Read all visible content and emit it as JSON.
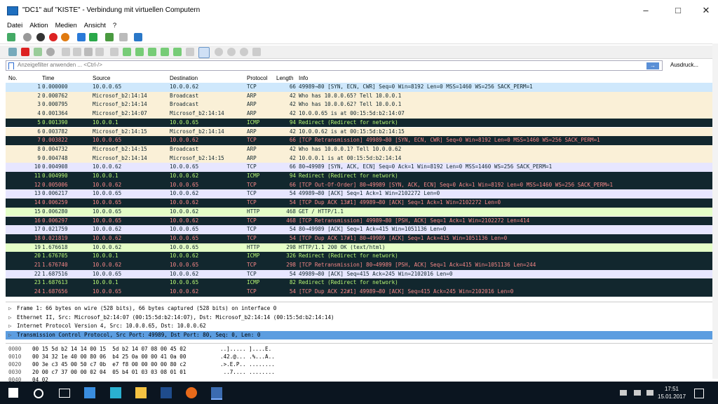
{
  "window": {
    "title": "\"DC1\" auf \"KISTE\" - Verbindung mit virtuellen Computern"
  },
  "menu": [
    "Datei",
    "Aktion",
    "Medien",
    "Ansicht",
    "?"
  ],
  "filter": {
    "placeholder": "Anzeigefilter anwenden ... <Ctrl-/>",
    "expression_label": "Ausdruck..."
  },
  "columns": [
    "No.",
    "Time",
    "Source",
    "Destination",
    "Protocol",
    "Length",
    "Info"
  ],
  "packets": [
    {
      "no": "1",
      "time": "0.000000",
      "src": "10.0.0.65",
      "dst": "10.0.0.62",
      "proto": "TCP",
      "len": "66",
      "info": "49989→80 [SYN, ECN, CWR] Seq=0 Win=8192 Len=0 MSS=1460 WS=256 SACK_PERM=1",
      "style": "sel"
    },
    {
      "no": "2",
      "time": "0.000762",
      "src": "Microsof_b2:14:14",
      "dst": "Broadcast",
      "proto": "ARP",
      "len": "42",
      "info": "Who has 10.0.0.65? Tell 10.0.0.1",
      "style": "arp"
    },
    {
      "no": "3",
      "time": "0.000795",
      "src": "Microsof_b2:14:14",
      "dst": "Broadcast",
      "proto": "ARP",
      "len": "42",
      "info": "Who has 10.0.0.62? Tell 10.0.0.1",
      "style": "arp"
    },
    {
      "no": "4",
      "time": "0.001364",
      "src": "Microsof_b2:14:07",
      "dst": "Microsof_b2:14:14",
      "proto": "ARP",
      "len": "42",
      "info": "10.0.0.65 is at 00:15:5d:b2:14:07",
      "style": "arp"
    },
    {
      "no": "5",
      "time": "0.001390",
      "src": "10.0.0.1",
      "dst": "10.0.0.65",
      "proto": "ICMP",
      "len": "94",
      "info": "Redirect             (Redirect for network)",
      "style": "icmp"
    },
    {
      "no": "6",
      "time": "0.003782",
      "src": "Microsof_b2:14:15",
      "dst": "Microsof_b2:14:14",
      "proto": "ARP",
      "len": "42",
      "info": "10.0.0.62 is at 00:15:5d:b2:14:15",
      "style": "arp"
    },
    {
      "no": "7",
      "time": "0.003822",
      "src": "10.0.0.65",
      "dst": "10.0.0.62",
      "proto": "TCP",
      "len": "66",
      "info": "[TCP Retransmission] 49989→80 [SYN, ECN, CWR] Seq=0 Win=8192 Len=0 MSS=1460 WS=256 SACK_PERM=1",
      "style": "bad"
    },
    {
      "no": "8",
      "time": "0.004732",
      "src": "Microsof_b2:14:15",
      "dst": "Broadcast",
      "proto": "ARP",
      "len": "42",
      "info": "Who has 10.0.0.1? Tell 10.0.0.62",
      "style": "arp"
    },
    {
      "no": "9",
      "time": "0.004748",
      "src": "Microsof_b2:14:14",
      "dst": "Microsof_b2:14:15",
      "proto": "ARP",
      "len": "42",
      "info": "10.0.0.1 is at 00:15:5d:b2:14:14",
      "style": "arp"
    },
    {
      "no": "10",
      "time": "0.004908",
      "src": "10.0.0.62",
      "dst": "10.0.0.65",
      "proto": "TCP",
      "len": "66",
      "info": "80→49989 [SYN, ACK, ECN] Seq=0 Ack=1 Win=8192 Len=0 MSS=1460 WS=256 SACK_PERM=1",
      "style": "tcpok"
    },
    {
      "no": "11",
      "time": "0.004990",
      "src": "10.0.0.1",
      "dst": "10.0.0.62",
      "proto": "ICMP",
      "len": "94",
      "info": "Redirect             (Redirect for network)",
      "style": "icmp"
    },
    {
      "no": "12",
      "time": "0.005006",
      "src": "10.0.0.62",
      "dst": "10.0.0.65",
      "proto": "TCP",
      "len": "66",
      "info": "[TCP Out-Of-Order] 80→49989 [SYN, ACK, ECN] Seq=0 Ack=1 Win=8192 Len=0 MSS=1460 WS=256 SACK_PERM=1",
      "style": "bad"
    },
    {
      "no": "13",
      "time": "0.006217",
      "src": "10.0.0.65",
      "dst": "10.0.0.62",
      "proto": "TCP",
      "len": "54",
      "info": "49989→80 [ACK] Seq=1 Ack=1 Win=2102272 Len=0",
      "style": "tcpok"
    },
    {
      "no": "14",
      "time": "0.006259",
      "src": "10.0.0.65",
      "dst": "10.0.0.62",
      "proto": "TCP",
      "len": "54",
      "info": "[TCP Dup ACK 13#1] 49989→80 [ACK] Seq=1 Ack=1 Win=2102272 Len=0",
      "style": "bad"
    },
    {
      "no": "15",
      "time": "0.006280",
      "src": "10.0.0.65",
      "dst": "10.0.0.62",
      "proto": "HTTP",
      "len": "468",
      "info": "GET / HTTP/1.1",
      "style": "http"
    },
    {
      "no": "16",
      "time": "0.006297",
      "src": "10.0.0.65",
      "dst": "10.0.0.62",
      "proto": "TCP",
      "len": "468",
      "info": "[TCP Retransmission] 49989→80 [PSH, ACK] Seq=1 Ack=1 Win=2102272 Len=414",
      "style": "bad"
    },
    {
      "no": "17",
      "time": "0.021759",
      "src": "10.0.0.62",
      "dst": "10.0.0.65",
      "proto": "TCP",
      "len": "54",
      "info": "80→49989 [ACK] Seq=1 Ack=415 Win=1051136 Len=0",
      "style": "tcpok"
    },
    {
      "no": "18",
      "time": "0.021819",
      "src": "10.0.0.62",
      "dst": "10.0.0.65",
      "proto": "TCP",
      "len": "54",
      "info": "[TCP Dup ACK 17#1] 80→49989 [ACK] Seq=1 Ack=415 Win=1051136 Len=0",
      "style": "bad"
    },
    {
      "no": "19",
      "time": "1.676618",
      "src": "10.0.0.62",
      "dst": "10.0.0.65",
      "proto": "HTTP",
      "len": "298",
      "info": "HTTP/1.1 200 OK  (text/html)",
      "style": "http"
    },
    {
      "no": "20",
      "time": "1.676705",
      "src": "10.0.0.1",
      "dst": "10.0.0.62",
      "proto": "ICMP",
      "len": "326",
      "info": "Redirect             (Redirect for network)",
      "style": "icmp"
    },
    {
      "no": "21",
      "time": "1.676740",
      "src": "10.0.0.62",
      "dst": "10.0.0.65",
      "proto": "TCP",
      "len": "298",
      "info": "[TCP Retransmission] 80→49989 [PSH, ACK] Seq=1 Ack=415 Win=1051136 Len=244",
      "style": "bad"
    },
    {
      "no": "22",
      "time": "1.687516",
      "src": "10.0.0.65",
      "dst": "10.0.0.62",
      "proto": "TCP",
      "len": "54",
      "info": "49989→80 [ACK] Seq=415 Ack=245 Win=2102016 Len=0",
      "style": "tcpok"
    },
    {
      "no": "23",
      "time": "1.687613",
      "src": "10.0.0.1",
      "dst": "10.0.0.65",
      "proto": "ICMP",
      "len": "82",
      "info": "Redirect             (Redirect for network)",
      "style": "icmp"
    },
    {
      "no": "24",
      "time": "1.687656",
      "src": "10.0.0.65",
      "dst": "10.0.0.62",
      "proto": "TCP",
      "len": "54",
      "info": "[TCP Dup ACK 22#1] 49989→80 [ACK] Seq=415 Ack=245 Win=2102016 Len=0",
      "style": "bad"
    }
  ],
  "details": [
    {
      "text": "Frame 1: 66 bytes on wire (528 bits), 66 bytes captured (528 bits) on interface 0",
      "hl": false
    },
    {
      "text": "Ethernet II, Src: Microsof_b2:14:07 (00:15:5d:b2:14:07), Dst: Microsof_b2:14:14 (00:15:5d:b2:14:14)",
      "hl": false
    },
    {
      "text": "Internet Protocol Version 4, Src: 10.0.0.65, Dst: 10.0.0.62",
      "hl": false
    },
    {
      "text": "Transmission Control Protocol, Src Port: 49989, Dst Port: 80, Seq: 0, Len: 0",
      "hl": true
    }
  ],
  "hex": [
    {
      "off": "0000",
      "hex": "00 15 5d b2 14 14 00 15  5d b2 14 07 08 00 45 02",
      "ascii": "..]..... ]....E."
    },
    {
      "off": "0010",
      "hex": "00 34 32 1e 40 00 80 06  b4 25 0a 00 00 41 0a 00",
      "ascii": ".42.@... .%...A.."
    },
    {
      "off": "0020",
      "hex": "00 3e c3 45 00 50 c7 0b  e7 f8 00 00 00 00 80 c2",
      "ascii": ".>.E.P.. ........"
    },
    {
      "off": "0030",
      "hex": "20 00 c7 37 00 00 02 04  05 b4 01 03 03 08 01 01",
      "ascii": " ..7.... ........"
    },
    {
      "off": "0040",
      "hex": "04 02",
      "ascii": ""
    }
  ],
  "taskbar": {
    "time": "17:51",
    "date": "15.01.2017"
  }
}
